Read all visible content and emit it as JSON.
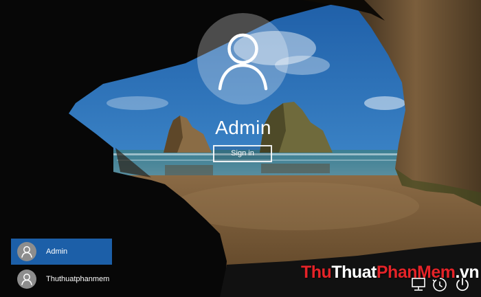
{
  "wallpaper": {
    "sky_color": "#2f74c0",
    "sea_color": "#2f6f86",
    "sand_color": "#7a5a35",
    "cave_color": "#2a1f14"
  },
  "current_user": {
    "name": "Admin",
    "sign_in_label": "Sign in",
    "avatar_icon": "user-icon"
  },
  "user_list": [
    {
      "name": "Admin",
      "selected": true,
      "icon": "user-icon"
    },
    {
      "name": "Thuthuatphanmem",
      "selected": false,
      "icon": "user-icon"
    }
  ],
  "watermark": {
    "part1": "Thu",
    "part2": "Thuat",
    "part3": "PhanMem",
    "part4": ".vn",
    "accent_color": "#e52328"
  },
  "system_tray": {
    "icons": [
      "network-icon",
      "ease-of-access-icon",
      "power-icon"
    ]
  }
}
